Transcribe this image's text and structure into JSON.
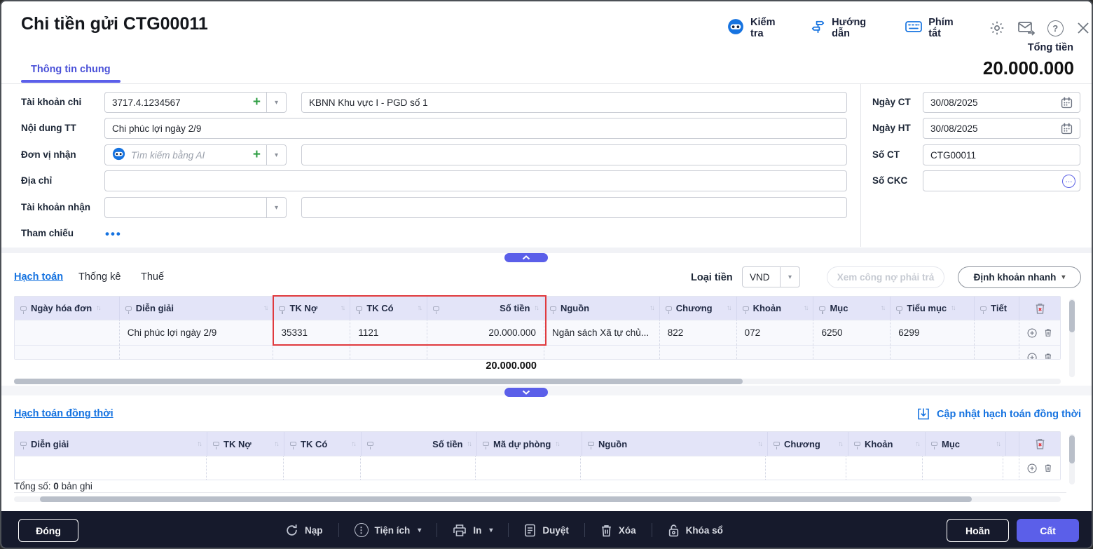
{
  "window": {
    "title": "Chi tiền gửi CTG00011"
  },
  "header": {
    "actions": {
      "check": "Kiểm tra",
      "guide": "Hướng dẫn",
      "shortcut": "Phím tắt"
    },
    "total_label": "Tổng tiền",
    "total_value": "20.000.000",
    "tab_general": "Thông tin chung"
  },
  "form": {
    "pay_account": {
      "label": "Tài khoản chi",
      "value": "3717.4.1234567",
      "bank_name": "KBNN Khu vực I - PGD số 1"
    },
    "payment_content": {
      "label": "Nội dung TT",
      "value": "Chi phúc lợi ngày 2/9"
    },
    "receiver": {
      "label": "Đơn vị nhận",
      "placeholder": "Tìm kiếm bằng AI",
      "name": ""
    },
    "address": {
      "label": "Địa chỉ",
      "value": ""
    },
    "receive_account": {
      "label": "Tài khoản nhận",
      "value": "",
      "bank_name": ""
    },
    "reference": {
      "label": "Tham chiếu"
    }
  },
  "right_panel": {
    "doc_date": {
      "label": "Ngày CT",
      "value": "30/08/2025"
    },
    "post_date": {
      "label": "Ngày HT",
      "value": "30/08/2025"
    },
    "doc_no": {
      "label": "Số CT",
      "value": "CTG00011"
    },
    "ckc_no": {
      "label": "Số CKC",
      "value": ""
    }
  },
  "accounting": {
    "tabs": [
      "Hạch toán",
      "Thống kê",
      "Thuế"
    ],
    "currency_label": "Loại tiền",
    "currency": "VND",
    "buttons": {
      "view_debt": "Xem công nợ phải trả",
      "quick_entry": "Định khoản nhanh"
    },
    "table": {
      "columns": [
        "Ngày hóa đơn",
        "Diễn giải",
        "TK Nợ",
        "TK Có",
        "Số tiền",
        "Nguồn",
        "Chương",
        "Khoản",
        "Mục",
        "Tiểu mục",
        "Tiết"
      ],
      "row": [
        "",
        "Chi phúc lợi ngày 2/9",
        "35331",
        "1121",
        "20.000.000",
        "Ngân sách Xã tự chủ...",
        "822",
        "072",
        "6250",
        "6299",
        ""
      ],
      "total": "20.000.000"
    }
  },
  "simultaneous": {
    "title": "Hạch toán đồng thời",
    "update_link": "Cập nhật hạch toán đồng thời",
    "columns": [
      "Diễn giải",
      "TK Nợ",
      "TK Có",
      "Số tiền",
      "Mã dự phòng",
      "Nguồn",
      "Chương",
      "Khoản",
      "Mục"
    ],
    "summary_label": "Tổng số:",
    "summary_count": "0",
    "summary_unit": "bản ghi"
  },
  "footer": {
    "close": "Đóng",
    "reload": "Nạp",
    "utilities": "Tiện ích",
    "print": "In",
    "approve": "Duyệt",
    "delete": "Xóa",
    "lock": "Khóa sổ",
    "postpone": "Hoãn",
    "save": "Cất"
  },
  "icons": {
    "sort": "↑↓",
    "caret": "▾",
    "plus": "+",
    "dots": "•••",
    "ellipsis": "...",
    "question": "?",
    "menu_dots": "⋮"
  },
  "colors": {
    "accent": "#5b5fe9",
    "link_blue": "#1673e0",
    "highlight_red": "#e03a3e",
    "plus_green": "#2f9e44",
    "table_header_bg": "#e3e4f8",
    "footer_bg": "#161a2c"
  }
}
